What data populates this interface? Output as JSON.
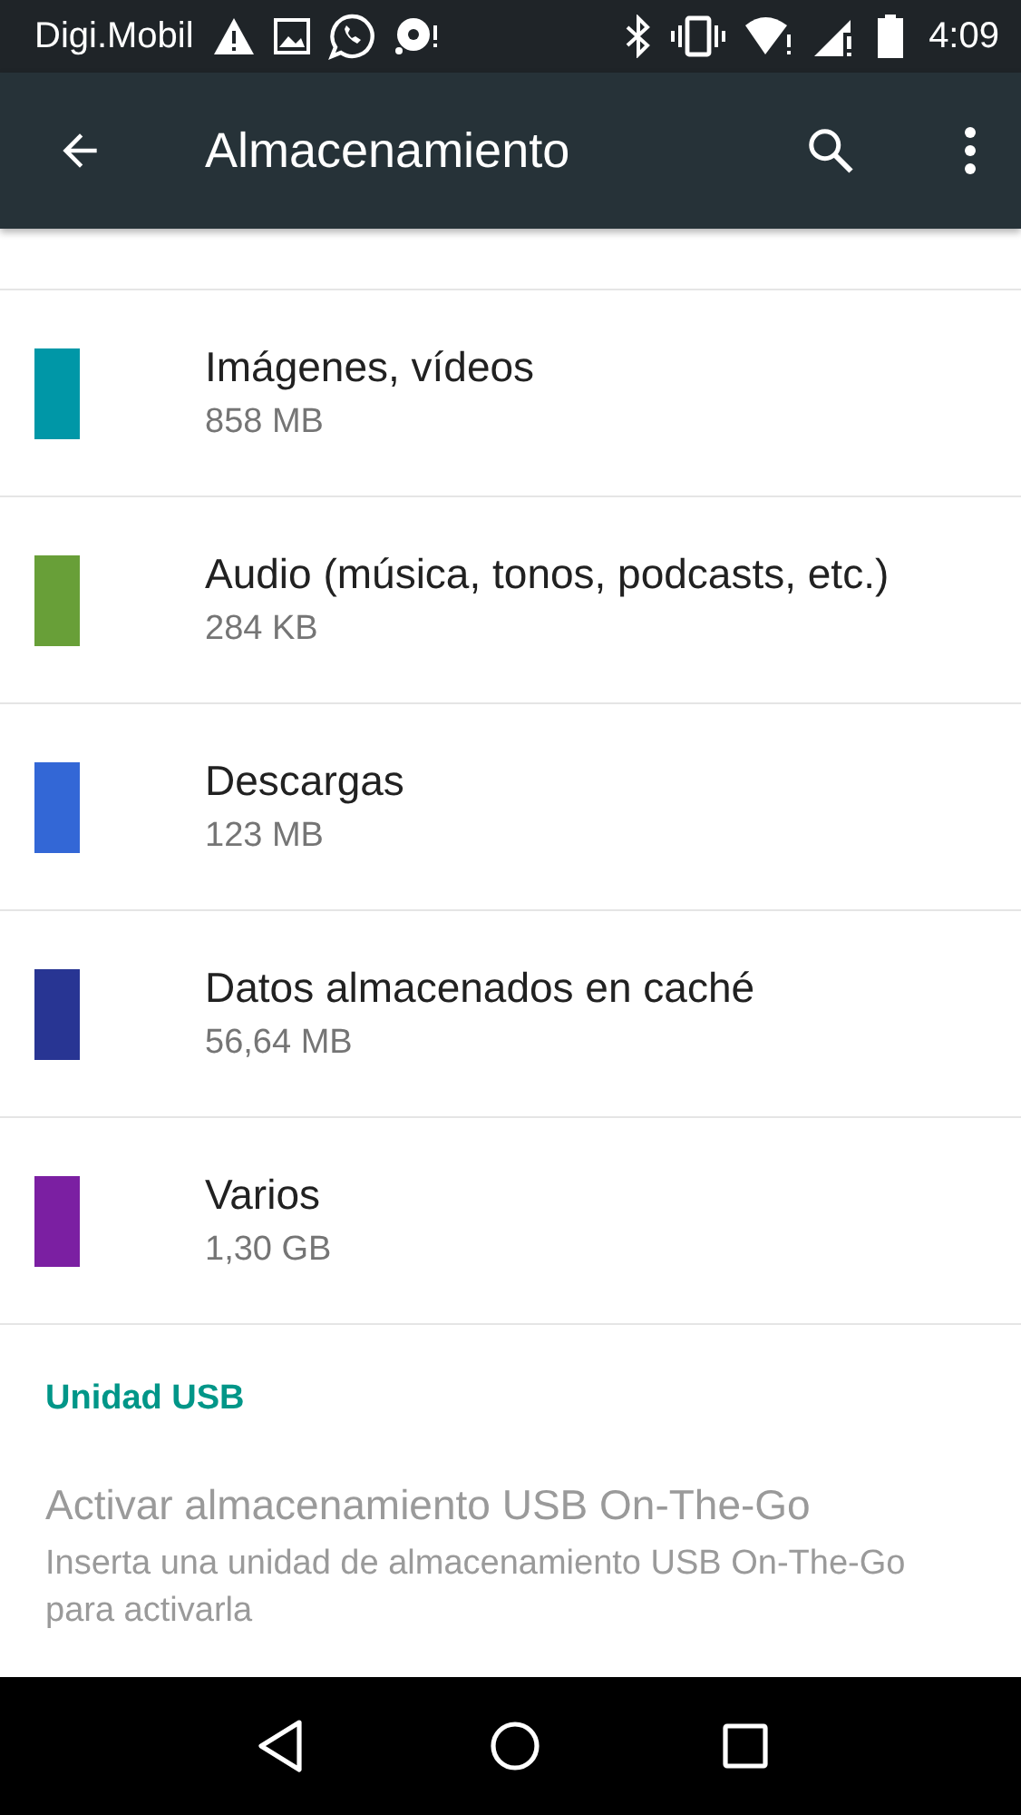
{
  "status_bar": {
    "carrier": "Digi.Mobil",
    "time": "4:09"
  },
  "app_bar": {
    "title": "Almacenamiento"
  },
  "categories": [
    {
      "title": "Imágenes, vídeos",
      "size": "858 MB",
      "color": "#0097a7"
    },
    {
      "title": "Audio (música, tonos, podcasts, etc.)",
      "size": "284 KB",
      "color": "#689f38"
    },
    {
      "title": "Descargas",
      "size": "123 MB",
      "color": "#3367d6"
    },
    {
      "title": "Datos almacenados en caché",
      "size": "56,64 MB",
      "color": "#283593"
    },
    {
      "title": "Varios",
      "size": "1,30 GB",
      "color": "#7b1fa2"
    }
  ],
  "usb_section": {
    "header": "Unidad USB",
    "items": [
      {
        "title": "Activar almacenamiento USB On-The-Go",
        "summary": "Inserta una unidad de almacenamiento USB On-The-Go para activarla",
        "disabled": true
      }
    ]
  }
}
